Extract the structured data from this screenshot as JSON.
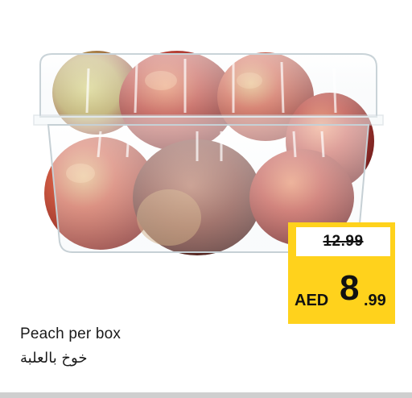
{
  "product": {
    "name_en": "Peach per box",
    "name_ar": "خوخ بالعلبة",
    "image_icon": "peach-box-image"
  },
  "price": {
    "old": "12.99",
    "currency": "AED",
    "integer": "8",
    "decimal": ".99",
    "badge_color": "#ffd21c"
  }
}
